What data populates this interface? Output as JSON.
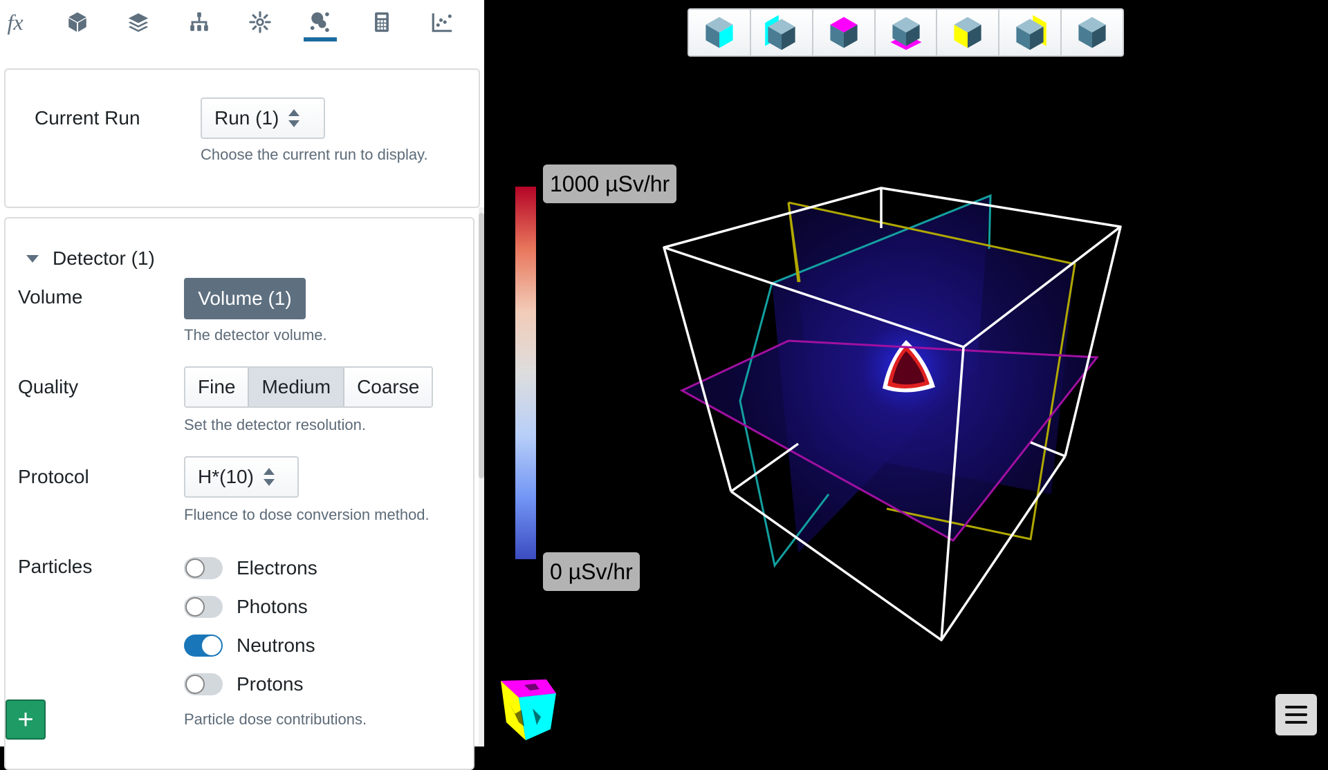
{
  "iconbar": {
    "tabs": [
      {
        "icon": "function-icon",
        "active": false
      },
      {
        "icon": "cube-icon",
        "active": false
      },
      {
        "icon": "layers-icon",
        "active": false
      },
      {
        "icon": "hierarchy-icon",
        "active": false
      },
      {
        "icon": "source-icon",
        "active": false
      },
      {
        "icon": "particles-icon",
        "active": true
      },
      {
        "icon": "calculator-icon",
        "active": false
      },
      {
        "icon": "scatter-plot-icon",
        "active": false
      }
    ],
    "fx_glyph": "fx"
  },
  "run": {
    "label": "Current Run",
    "value": "Run (1)",
    "help": "Choose the current run to display."
  },
  "detector": {
    "title": "Detector (1)",
    "volume": {
      "label": "Volume",
      "value": "Volume (1)",
      "help": "The detector volume."
    },
    "quality": {
      "label": "Quality",
      "options": [
        "Fine",
        "Medium",
        "Coarse"
      ],
      "selected": "Medium",
      "help": "Set the detector resolution."
    },
    "protocol": {
      "label": "Protocol",
      "value": "H*(10)",
      "help": "Fluence to dose conversion method."
    },
    "particles": {
      "label": "Particles",
      "items": [
        {
          "name": "Electrons",
          "on": false
        },
        {
          "name": "Photons",
          "on": false
        },
        {
          "name": "Neutrons",
          "on": true
        },
        {
          "name": "Protons",
          "on": false
        }
      ],
      "help": "Particle dose contributions."
    }
  },
  "add_button": "+",
  "viewport": {
    "view_buttons": [
      "view-right",
      "view-left",
      "view-top",
      "view-bottom",
      "view-front",
      "view-back",
      "view-isometric"
    ],
    "colorbar": {
      "max_label": "1000 µSv/hr",
      "min_label": "0 µSv/hr",
      "colors": [
        "#b40426",
        "#dddddd",
        "#3b4cc0"
      ]
    },
    "slice_colors": {
      "x": "#14a0a0",
      "y": "#b0a800",
      "z": "#a010a0",
      "box": "#ffffff"
    }
  }
}
